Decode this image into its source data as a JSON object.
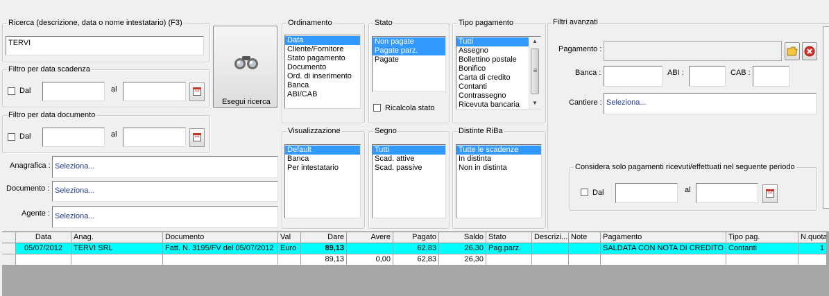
{
  "search": {
    "legend": "Ricerca (descrizione, data o nome intestatario) (F3)",
    "value": "TERVI",
    "button_label": "Esegui ricerca"
  },
  "due_date_filter": {
    "legend": "Filtro per data scadenza",
    "dal_label": "Dal",
    "al_label": "al",
    "from_value": "",
    "to_value": ""
  },
  "doc_date_filter": {
    "legend": "Filtro per data documento",
    "dal_label": "Dal",
    "al_label": "al",
    "from_value": "",
    "to_value": ""
  },
  "lookups": {
    "anagrafica_label": "Anagrafica :",
    "anagrafica_value": "Seleziona...",
    "documento_label": "Documento :",
    "documento_value": "Seleziona...",
    "agente_label": "Agente :",
    "agente_value": "Seleziona..."
  },
  "ordinamento": {
    "legend": "Ordinamento",
    "items": [
      "Data",
      "Cliente/Fornitore",
      "Stato pagamento",
      "Documento",
      "Ord. di inserimento",
      "Banca",
      "ABI/CAB"
    ],
    "selected": [
      0
    ]
  },
  "stato": {
    "legend": "Stato",
    "items": [
      "Non pagate",
      "Pagate parz.",
      "Pagate"
    ],
    "selected": [
      0,
      1
    ],
    "ricalcola_label": "Ricalcola stato"
  },
  "tipo_pagamento": {
    "legend": "Tipo pagamento",
    "items": [
      "Tutti",
      "Assegno",
      "Bollettino postale",
      "Bonifico",
      "Carta di credito",
      "Contanti",
      "Contrassegno",
      "Ricevuta bancaria"
    ],
    "selected": [
      0
    ]
  },
  "visualizzazione": {
    "legend": "Visualizzazione",
    "items": [
      "Default",
      "Banca",
      "Per intestatario"
    ],
    "selected": [
      0
    ]
  },
  "segno": {
    "legend": "Segno",
    "items": [
      "Tutti",
      "Scad. attive",
      "Scad. passive"
    ],
    "selected": [
      0
    ]
  },
  "distinte": {
    "legend": "Distinte RiBa",
    "items": [
      "Tutte le scadenze",
      "In distinta",
      "Non in distinta"
    ],
    "selected": [
      0
    ]
  },
  "advanced": {
    "legend": "Filtri avanzati",
    "pagamento_label": "Pagamento :",
    "pagamento_value": "",
    "banca_label": "Banca :",
    "banca_value": "",
    "abi_label": "ABI :",
    "abi_value": "",
    "cab_label": "CAB :",
    "cab_value": "",
    "cantiere_label": "Cantiere :",
    "cantiere_value": "Seleziona...",
    "period_legend": "Considera solo pagamenti ricevuti/effettuati nel seguente periodo",
    "dal_label": "Dal",
    "al_label": "al"
  },
  "grid": {
    "columns": [
      "Data",
      "Anag.",
      "Documento",
      "Val",
      "Dare",
      "Avere",
      "Pagato",
      "Saldo",
      "Stato",
      "Descrizi...",
      "Note",
      "Pagamento",
      "Tipo pag.",
      "N.quota"
    ],
    "rows": [
      [
        "05/07/2012",
        "TERVI SRL",
        "Fatt. N. 3195/FV del 05/07/2012",
        "Euro",
        "89,13",
        "",
        "62,83",
        "26,30",
        "Pag.parz.",
        "",
        "",
        "SALDATA CON NOTA DI CREDITO",
        "Contanti",
        "1"
      ]
    ],
    "totals": [
      "",
      "",
      "",
      "",
      "89,13",
      "0,00",
      "62,83",
      "26,30",
      "",
      "",
      "",
      "",
      "",
      ""
    ]
  },
  "colors": {
    "selection": "#3399ff",
    "row_highlight": "#00ffff",
    "window_bg": "#f0f0f0"
  }
}
